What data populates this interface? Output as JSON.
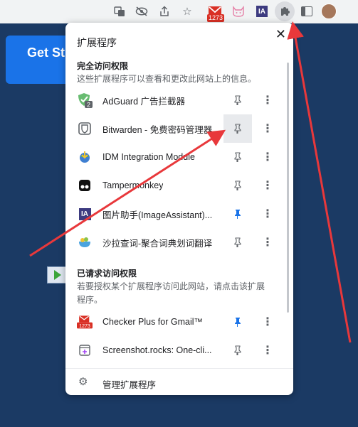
{
  "toolbar": {
    "gmail_badge": "1273",
    "ia_label": "IA"
  },
  "page": {
    "get_started": "Get St"
  },
  "popup": {
    "title": "扩展程序",
    "close": "✕",
    "full_access": {
      "title": "完全访问权限",
      "desc": "这些扩展程序可以查看和更改此网站上的信息。"
    },
    "requested": {
      "title": "已请求访问权限",
      "desc": "若要授权某个扩展程序访问此网站，请点击该扩展程序。"
    },
    "extensions": [
      {
        "name": "AdGuard 广告拦截器",
        "pinned": false
      },
      {
        "name": "Bitwarden - 免费密码管理器",
        "pinned": false
      },
      {
        "name": "IDM Integration Module",
        "pinned": false
      },
      {
        "name": "Tampermonkey",
        "pinned": false
      },
      {
        "name": "图片助手(ImageAssistant)...",
        "pinned": true
      },
      {
        "name": "沙拉查词-聚合词典划词翻译",
        "pinned": false
      }
    ],
    "requested_extensions": [
      {
        "name": "Checker Plus for Gmail™",
        "pinned": true,
        "badge": "1273"
      },
      {
        "name": "Screenshot.rocks: One-cli...",
        "pinned": false
      }
    ],
    "adguard_badge": "2",
    "manage": "管理扩展程序",
    "ia_label": "IA"
  },
  "colors": {
    "pin_active": "#1a73e8",
    "arrow": "#e8383b",
    "page_bg": "#1b3a64"
  }
}
